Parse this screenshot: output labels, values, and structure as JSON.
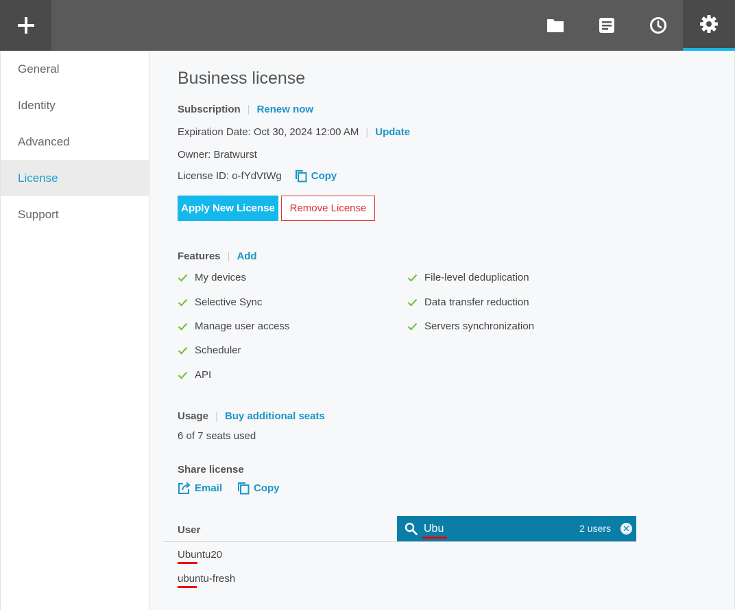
{
  "topbar": {
    "add_icon": "plus-icon",
    "icons": [
      "folder-icon",
      "list-icon",
      "clock-icon",
      "gear-icon"
    ],
    "active": "gear-icon"
  },
  "sidebar": {
    "items": [
      {
        "label": "General"
      },
      {
        "label": "Identity"
      },
      {
        "label": "Advanced"
      },
      {
        "label": "License"
      },
      {
        "label": "Support"
      }
    ],
    "active_index": 3
  },
  "license": {
    "title": "Business license",
    "subscription_label": "Subscription",
    "renew_link": "Renew now",
    "expiration": "Expiration Date: Oct 30, 2024 12:00 AM",
    "update_link": "Update",
    "owner": "Owner: Bratwurst",
    "license_id": "License ID: o-fYdVtWg",
    "copy_link": "Copy",
    "apply_button": "Apply New License",
    "remove_button": "Remove License"
  },
  "features": {
    "label": "Features",
    "add_link": "Add",
    "left": [
      "My devices",
      "Selective Sync",
      "Manage user access",
      "Scheduler",
      "API"
    ],
    "right": [
      "File-level deduplication",
      "Data transfer reduction",
      "Servers synchronization"
    ]
  },
  "usage": {
    "label": "Usage",
    "buy_link": "Buy additional seats",
    "seats": "6 of 7 seats used"
  },
  "share": {
    "label": "Share license",
    "email_link": "Email",
    "copy_link": "Copy"
  },
  "users": {
    "column": "User",
    "search_value": "Ubu",
    "count": "2 users",
    "clear_glyph": "✕",
    "rows": [
      "Ubuntu20",
      "ubuntu-fresh"
    ]
  },
  "colors": {
    "accent": "#18b4e6",
    "link": "#1a96c8",
    "danger": "#dd3333",
    "search_bg": "#0b7ea8",
    "check": "#7ac143"
  }
}
